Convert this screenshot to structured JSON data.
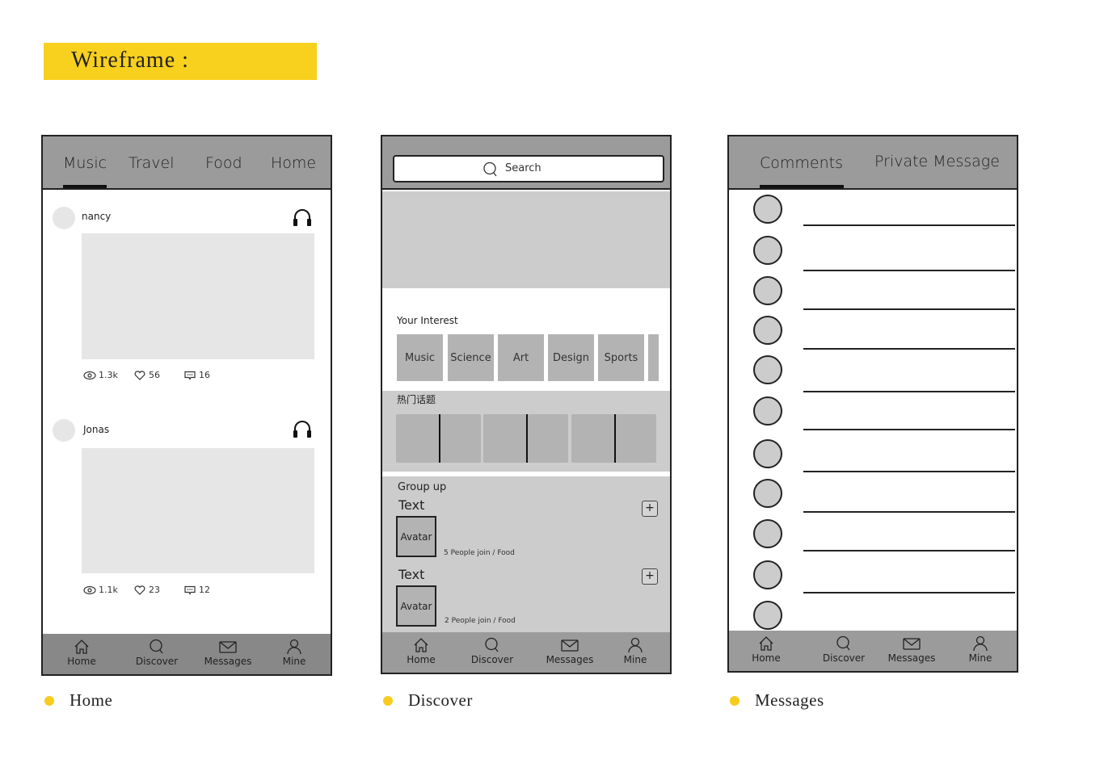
{
  "title": "Wireframe :",
  "colors": {
    "accent_yellow": "#f8d01e",
    "bar_gray": "#9b9b9b",
    "placeholder_gray": "#cccccc",
    "tile_gray": "#b3b3b3",
    "image_gray": "#e6e6e6",
    "ink": "#222222"
  },
  "bottom_nav": [
    {
      "label": "Home",
      "icon": "home-icon"
    },
    {
      "label": "Discover",
      "icon": "search-icon"
    },
    {
      "label": "Messages",
      "icon": "mail-icon"
    },
    {
      "label": "Mine",
      "icon": "user-icon"
    }
  ],
  "home": {
    "tabs": [
      {
        "label": "Music",
        "active": true
      },
      {
        "label": "Travel",
        "active": false
      },
      {
        "label": "Food",
        "active": false
      },
      {
        "label": "Home",
        "active": false
      }
    ],
    "posts": [
      {
        "user": "nancy",
        "icon": "headphones-icon",
        "views": "1.3k",
        "likes": "56",
        "comments": "16"
      },
      {
        "user": "Jonas",
        "icon": "headphones-icon",
        "views": "1.1k",
        "likes": "23",
        "comments": "12"
      }
    ]
  },
  "discover": {
    "search_placeholder": "Search",
    "interest_label": "Your Interest",
    "interests": [
      "Music",
      "Science",
      "Art",
      "Design",
      "Sports"
    ],
    "hot_topics_label": "热门话题",
    "group_label": "Group up",
    "groups": [
      {
        "title": "Text",
        "avatar": "Avatar",
        "meta": "5 People join / Food"
      },
      {
        "title": "Text",
        "avatar": "Avatar",
        "meta": "2 People join / Food"
      }
    ]
  },
  "messages": {
    "tabs": [
      {
        "label": "Comments",
        "active": true
      },
      {
        "label": "Private Message",
        "active": false
      }
    ],
    "row_count": 11
  },
  "captions": [
    "Home",
    "Discover",
    "Messages"
  ]
}
